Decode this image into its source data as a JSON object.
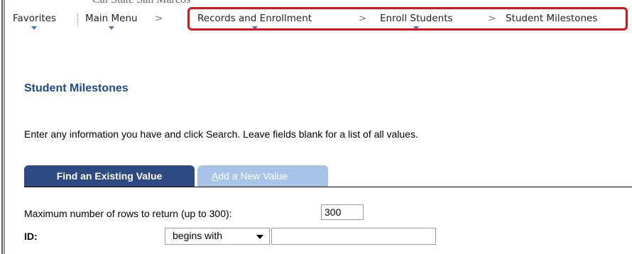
{
  "header": {
    "org_name": "Cal State San Marcos"
  },
  "nav": {
    "items": [
      {
        "label": "Favorites"
      },
      {
        "label": "Main Menu"
      },
      {
        "label": "Records and Enrollment"
      },
      {
        "label": "Enroll Students"
      },
      {
        "label": "Student Milestones"
      }
    ],
    "separator": ">"
  },
  "page": {
    "title": "Student Milestones",
    "instructions": "Enter any information you have and click Search. Leave fields blank for a list of all values."
  },
  "tabs": [
    {
      "label": "Find an Existing Value",
      "active": true
    },
    {
      "label_first": "A",
      "label_rest": "dd a New Value",
      "active": false
    }
  ],
  "search": {
    "max_rows_label": "Maximum number of rows to return (up to 300):",
    "max_rows_value": "300",
    "id_label": "ID:",
    "id_operator": "begins with",
    "id_value": ""
  },
  "colors": {
    "highlight": "#e0101a",
    "title": "#1f4a8a",
    "tab_active": "#2d4a82",
    "tab_inactive": "#a7c4e8",
    "nav_marker": "#3f77c9"
  }
}
